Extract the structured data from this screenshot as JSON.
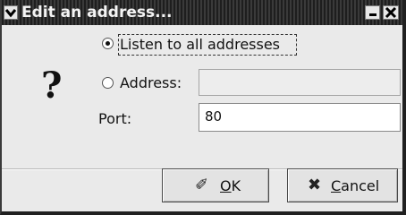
{
  "window": {
    "title": "Edit an address..."
  },
  "icons": {
    "window_menu": "chevron-down-icon",
    "minimize": "minimize-icon",
    "close": "close-x-icon",
    "dialog": "question-icon",
    "ok": "checkmark-pen-icon",
    "cancel": "x-cancel-icon"
  },
  "options": {
    "listen_all": {
      "label": "Listen to all addresses",
      "selected": true
    },
    "address": {
      "label": "Address:",
      "selected": false,
      "value": ""
    }
  },
  "port": {
    "label": "Port:",
    "value": "80"
  },
  "buttons": {
    "ok": {
      "mnemonic": "O",
      "rest": "K"
    },
    "cancel": {
      "mnemonic": "C",
      "rest": "ancel"
    }
  },
  "glyphs": {
    "question": "?",
    "ok_icon": "✐",
    "cancel_icon": "✖"
  }
}
